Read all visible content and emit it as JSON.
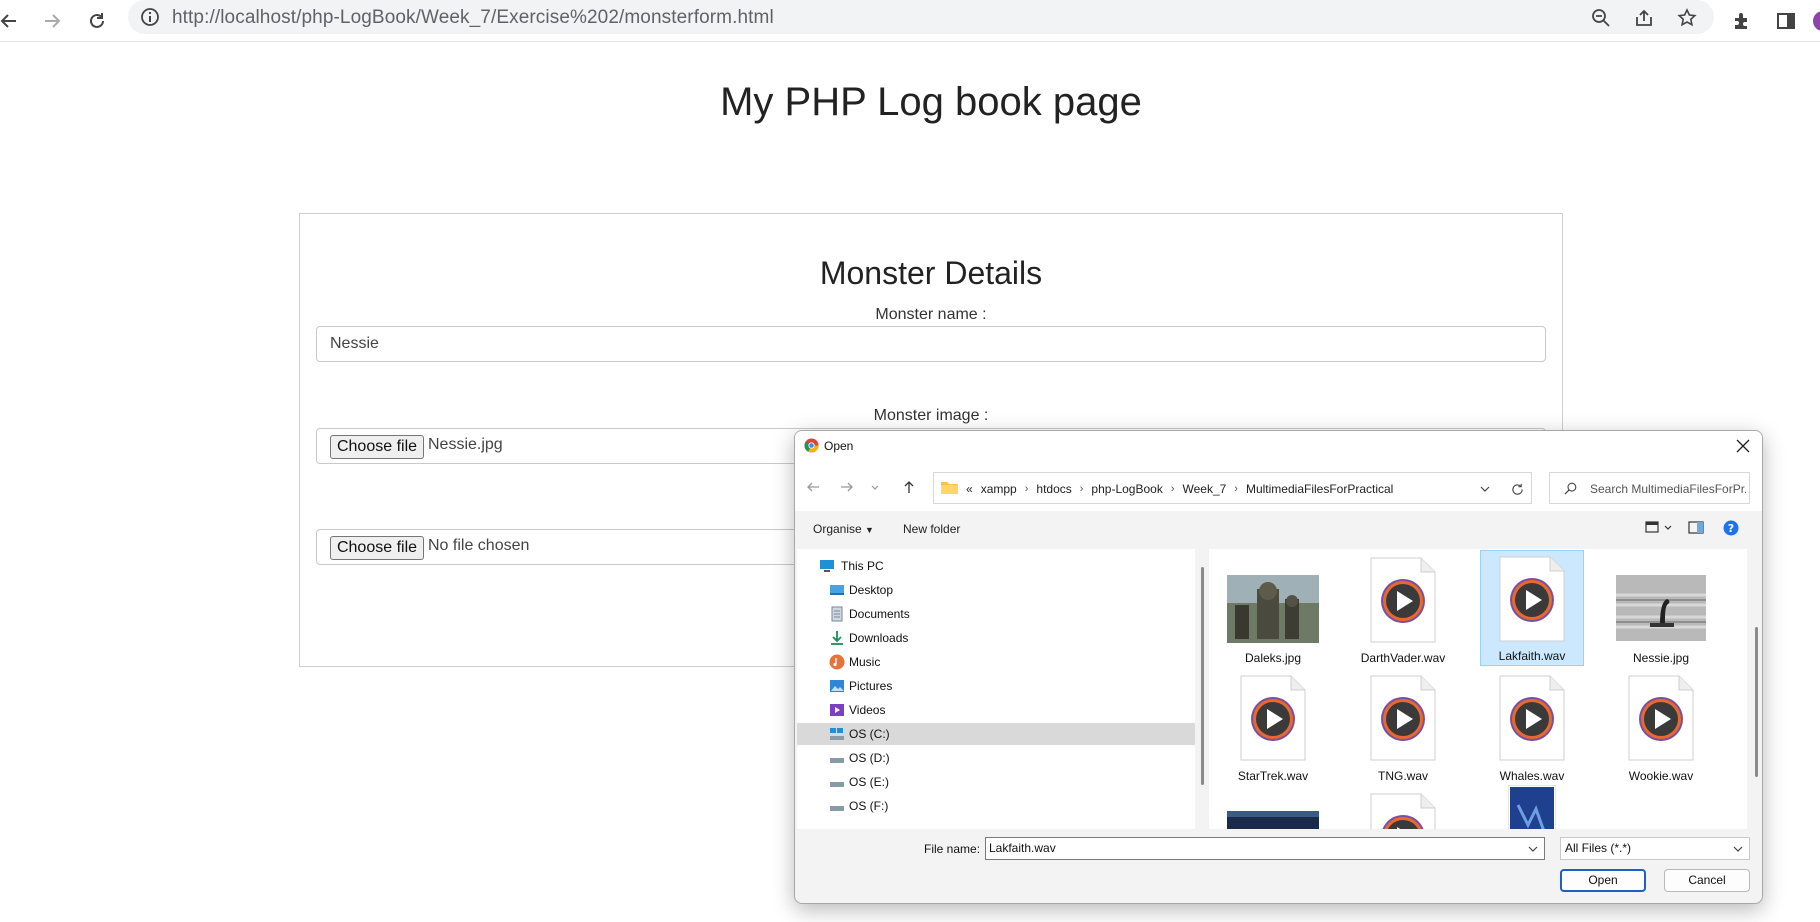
{
  "browser": {
    "url": "http://localhost/php-LogBook/Week_7/Exercise%202/monsterform.html",
    "icons": [
      "back-icon",
      "forward-icon",
      "reload-icon",
      "site-info-icon",
      "zoom-out-icon",
      "share-icon",
      "bookmark-star-icon",
      "extensions-icon",
      "side-panel-icon",
      "profile-avatar"
    ]
  },
  "page": {
    "heading": "My PHP Log book page",
    "form": {
      "title": "Monster Details",
      "name_label": "Monster name :",
      "name_value": "Nessie",
      "image_label": "Monster image :",
      "image_button": "Choose file",
      "image_file": "Nessie.jpg",
      "sound_button": "Choose file",
      "sound_file": "No file chosen"
    }
  },
  "dialog": {
    "title": "Open",
    "breadcrumbs": [
      "«",
      "xampp",
      "htdocs",
      "php-LogBook",
      "Week_7",
      "MultimediaFilesForPractical"
    ],
    "search_placeholder": "Search MultimediaFilesForPr...",
    "organise": "Organise",
    "new_folder": "New folder",
    "nav_items": [
      {
        "label": "This PC",
        "icon": "pc-icon"
      },
      {
        "label": "Desktop",
        "icon": "desktop-icon"
      },
      {
        "label": "Documents",
        "icon": "documents-icon"
      },
      {
        "label": "Downloads",
        "icon": "downloads-icon"
      },
      {
        "label": "Music",
        "icon": "music-icon"
      },
      {
        "label": "Pictures",
        "icon": "pictures-icon"
      },
      {
        "label": "Videos",
        "icon": "videos-icon"
      },
      {
        "label": "OS (C:)",
        "icon": "drive-icon",
        "selected": true
      },
      {
        "label": "OS (D:)",
        "icon": "drive-icon"
      },
      {
        "label": "OS (E:)",
        "icon": "drive-icon"
      },
      {
        "label": "OS (F:)",
        "icon": "drive-icon"
      }
    ],
    "files": [
      {
        "name": "Daleks.jpg",
        "kind": "image"
      },
      {
        "name": "DarthVader.wav",
        "kind": "audio"
      },
      {
        "name": "Lakfaith.wav",
        "kind": "audio",
        "selected": true
      },
      {
        "name": "Nessie.jpg",
        "kind": "image"
      },
      {
        "name": "StarTrek.wav",
        "kind": "audio"
      },
      {
        "name": "TNG.wav",
        "kind": "audio"
      },
      {
        "name": "Whales.wav",
        "kind": "audio"
      },
      {
        "name": "Wookie.wav",
        "kind": "audio"
      }
    ],
    "file_name_label": "File name:",
    "file_name_value": "Lakfaith.wav",
    "file_type": "All Files (*.*)",
    "open_button": "Open",
    "cancel_button": "Cancel"
  }
}
